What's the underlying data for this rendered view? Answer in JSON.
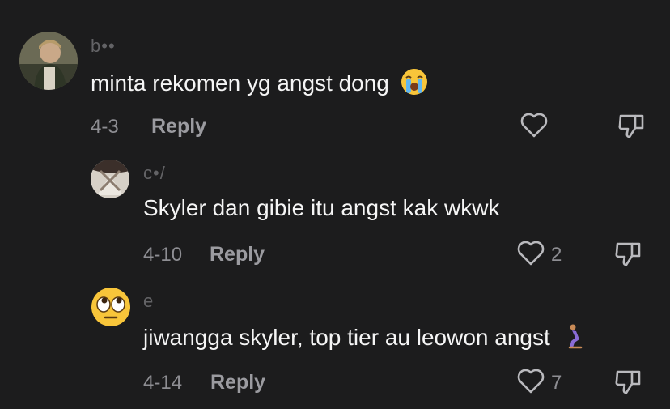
{
  "comments": [
    {
      "username": "b••",
      "text": "minta rekomen yg angst dong",
      "emoji": "loudly-crying-face",
      "date": "4-3",
      "reply_label": "Reply",
      "likes": ""
    },
    {
      "username": "c•/",
      "text": "Skyler dan gibie itu angst kak wkwk",
      "date": "4-10",
      "reply_label": "Reply",
      "likes": "2"
    },
    {
      "username": "e",
      "text": "jiwangga skyler, top tier au leowon angst",
      "emoji": "person-kneeling",
      "date": "4-14",
      "reply_label": "Reply",
      "likes": "7"
    }
  ],
  "colors": {
    "background": "#1c1c1d",
    "text": "#f5f5f5",
    "muted": "#8e8e93"
  }
}
